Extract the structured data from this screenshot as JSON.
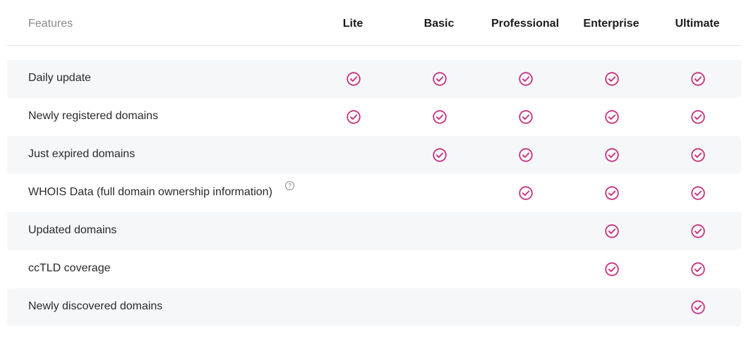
{
  "header": {
    "features_label": "Features",
    "plans": [
      "Lite",
      "Basic",
      "Professional",
      "Enterprise",
      "Ultimate"
    ]
  },
  "rows": [
    {
      "label": "Daily update",
      "has_help": false,
      "plans": [
        true,
        true,
        true,
        true,
        true
      ]
    },
    {
      "label": "Newly registered domains",
      "has_help": false,
      "plans": [
        true,
        true,
        true,
        true,
        true
      ]
    },
    {
      "label": "Just expired domains",
      "has_help": false,
      "plans": [
        false,
        true,
        true,
        true,
        true
      ]
    },
    {
      "label": "WHOIS Data (full domain ownership information)",
      "has_help": true,
      "plans": [
        false,
        false,
        true,
        true,
        true
      ]
    },
    {
      "label": "Updated domains",
      "has_help": false,
      "plans": [
        false,
        false,
        false,
        true,
        true
      ]
    },
    {
      "label": "ccTLD coverage",
      "has_help": false,
      "plans": [
        false,
        false,
        false,
        true,
        true
      ]
    },
    {
      "label": "Newly discovered domains",
      "has_help": false,
      "plans": [
        false,
        false,
        false,
        false,
        true
      ]
    }
  ],
  "help_glyph": "?",
  "colors": {
    "check": "#c5317f",
    "row_alt_bg": "#f6f7f9",
    "header_muted": "#8a8a8a"
  },
  "icons": {
    "check": "check-circle-icon",
    "help": "question-circle-icon"
  }
}
